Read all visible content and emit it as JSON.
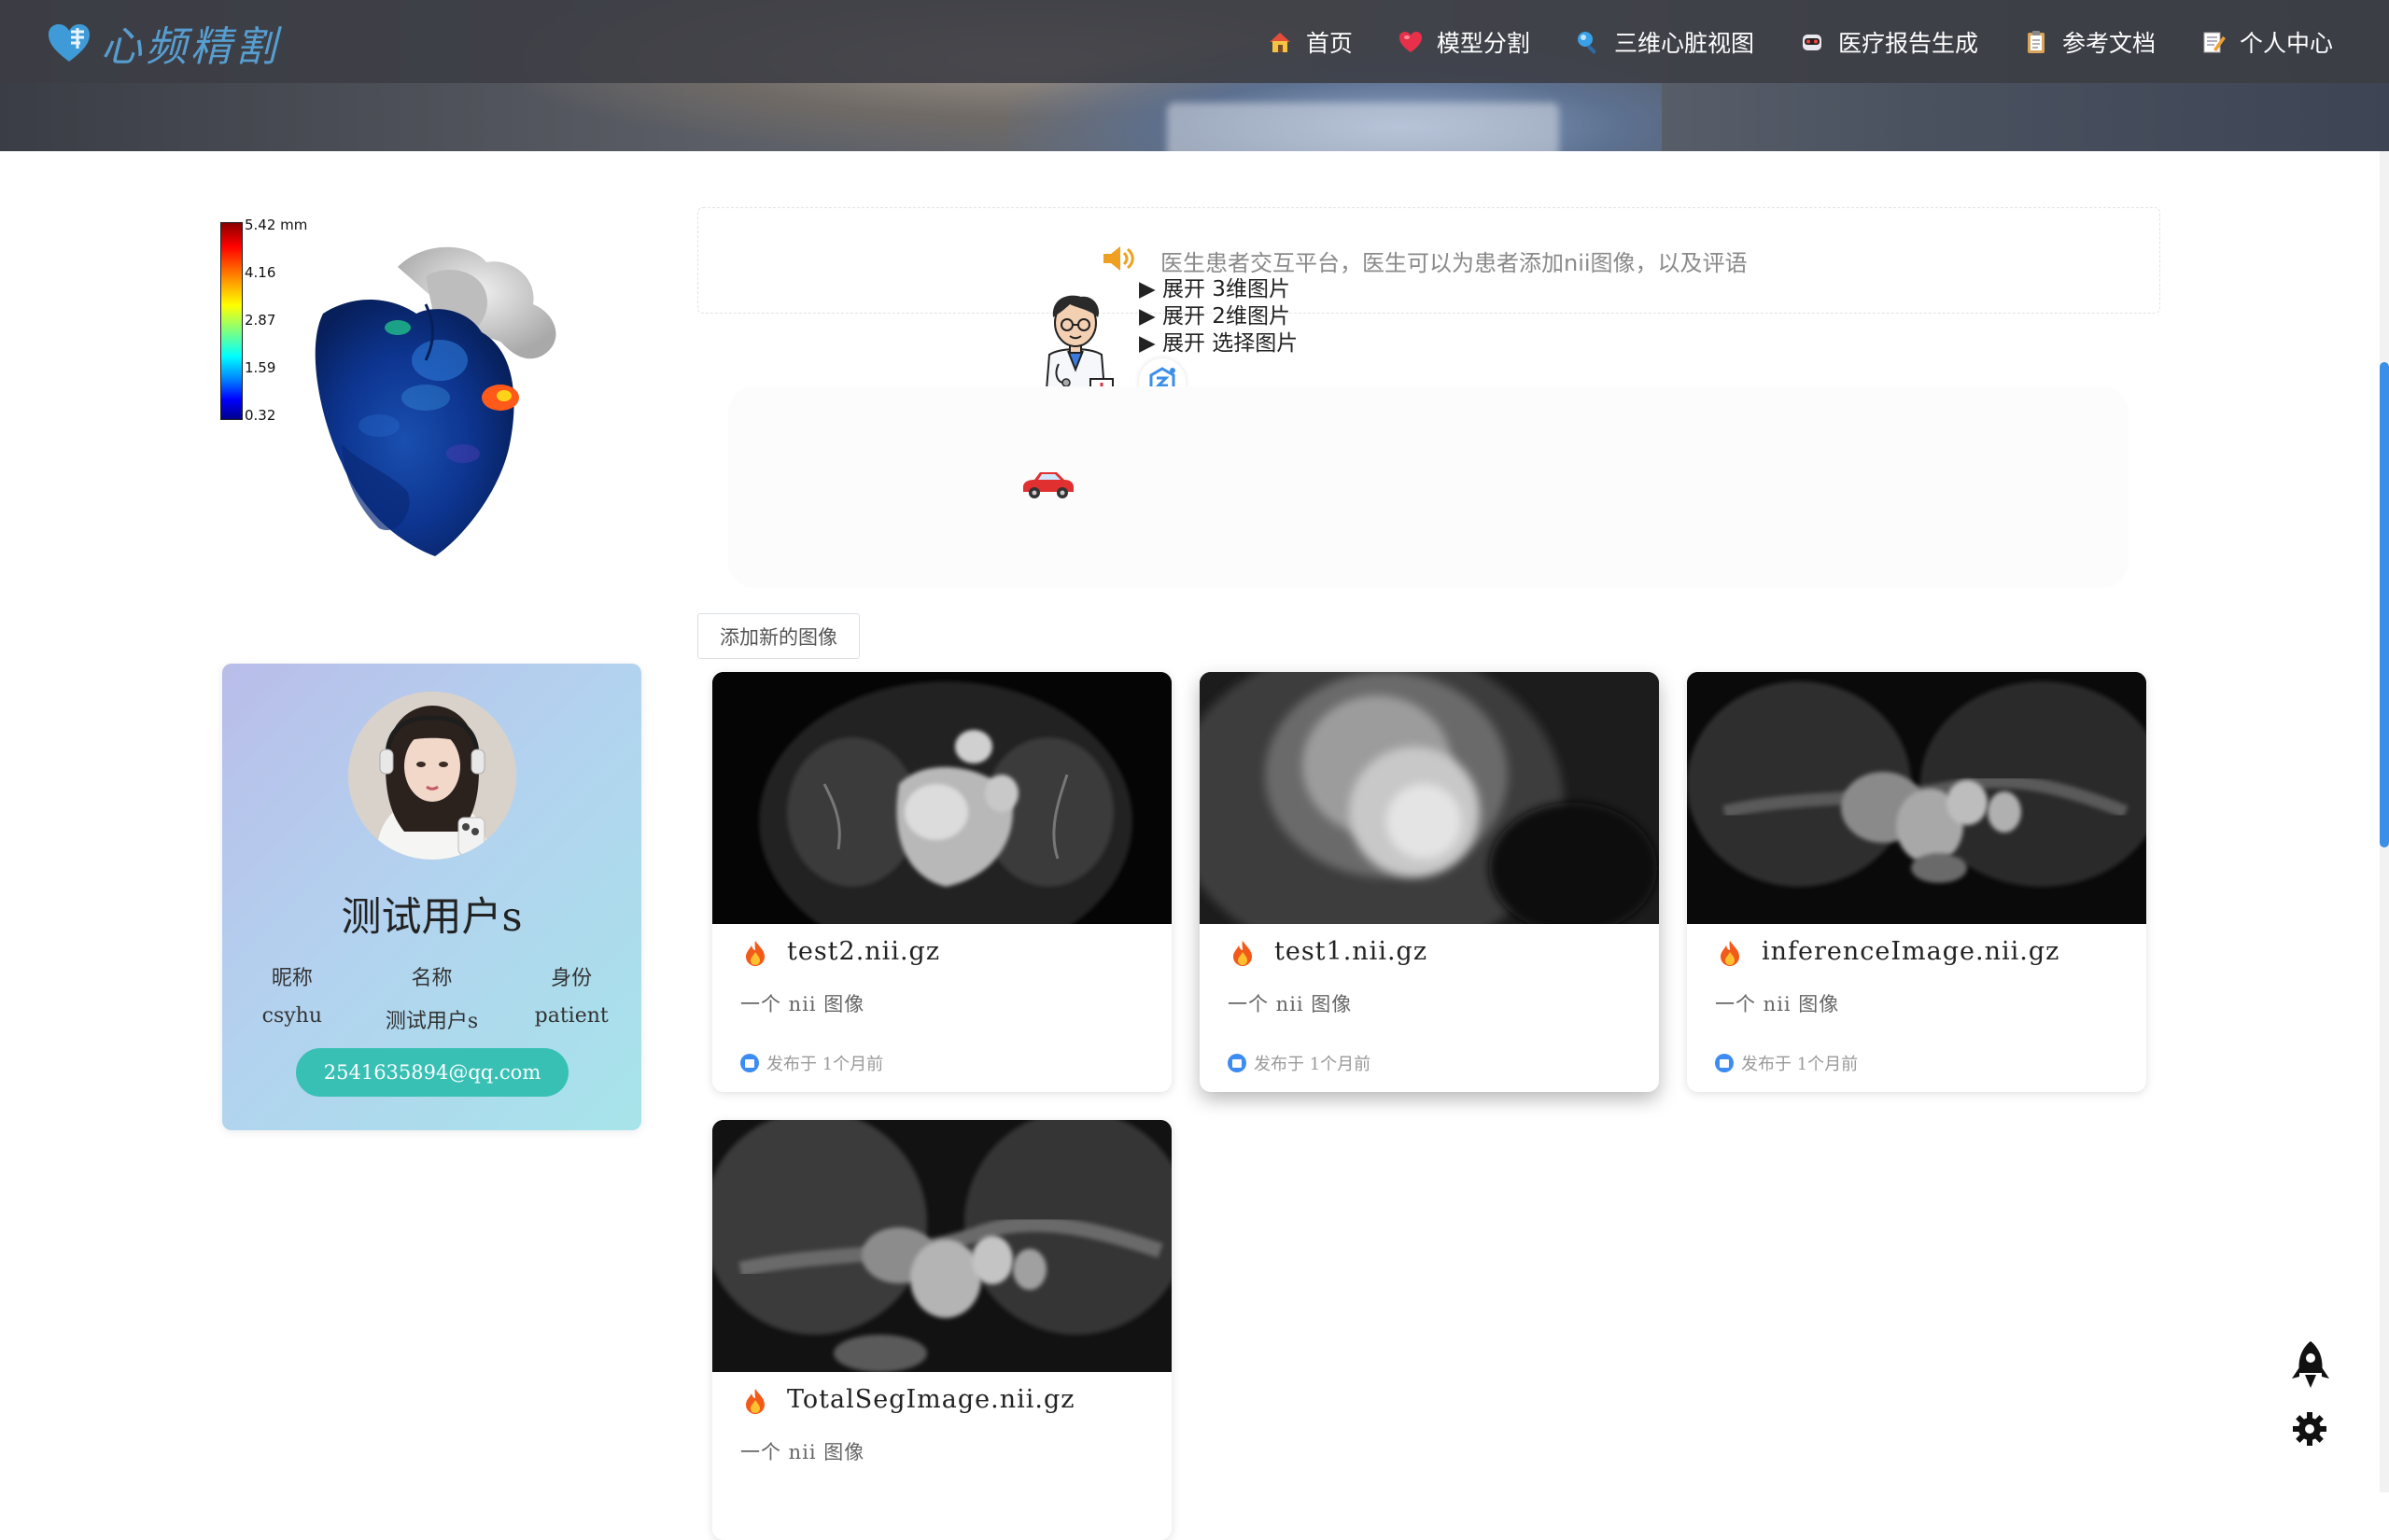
{
  "header": {
    "logo_text": "心频精割",
    "nav": [
      {
        "label": "首页",
        "icon": "home-icon"
      },
      {
        "label": "模型分割",
        "icon": "heart-icon"
      },
      {
        "label": "三维心脏视图",
        "icon": "magnifier-icon"
      },
      {
        "label": "医疗报告生成",
        "icon": "robot-icon"
      },
      {
        "label": "参考文档",
        "icon": "clipboard-icon"
      },
      {
        "label": "个人中心",
        "icon": "memo-icon"
      }
    ]
  },
  "heart_model": {
    "colorbar_labels": [
      "5.42 mm",
      "4.16",
      "2.87",
      "1.59",
      "0.32"
    ]
  },
  "notice": {
    "text": "医生患者交互平台，医生可以为患者添加nii图像，以及评语",
    "details": [
      "▶ 展开 3维图片",
      "▶ 展开 2维图片",
      "▶ 展开 选择图片"
    ]
  },
  "profile": {
    "display_name": "测试用户s",
    "headers": [
      "昵称",
      "名称",
      "身份"
    ],
    "values": [
      "csyhu",
      "测试用户s",
      "patient"
    ],
    "email": "2541635894@qq.com"
  },
  "actions": {
    "add_image_label": "添加新的图像"
  },
  "cards": [
    {
      "title": "test2.nii.gz",
      "desc": "一个 nii 图像",
      "posted": "发布于 1个月前"
    },
    {
      "title": "test1.nii.gz",
      "desc": "一个 nii 图像",
      "posted": "发布于 1个月前"
    },
    {
      "title": "inferenceImage.nii.gz",
      "desc": "一个 nii 图像",
      "posted": "发布于 1个月前"
    },
    {
      "title": "TotalSegImage.nii.gz",
      "desc": "一个 nii 图像",
      "posted": ""
    }
  ],
  "colors": {
    "accent": "#39c0b5",
    "link_blue": "#3b8fe8",
    "nav_bg": "#3c3e44"
  }
}
